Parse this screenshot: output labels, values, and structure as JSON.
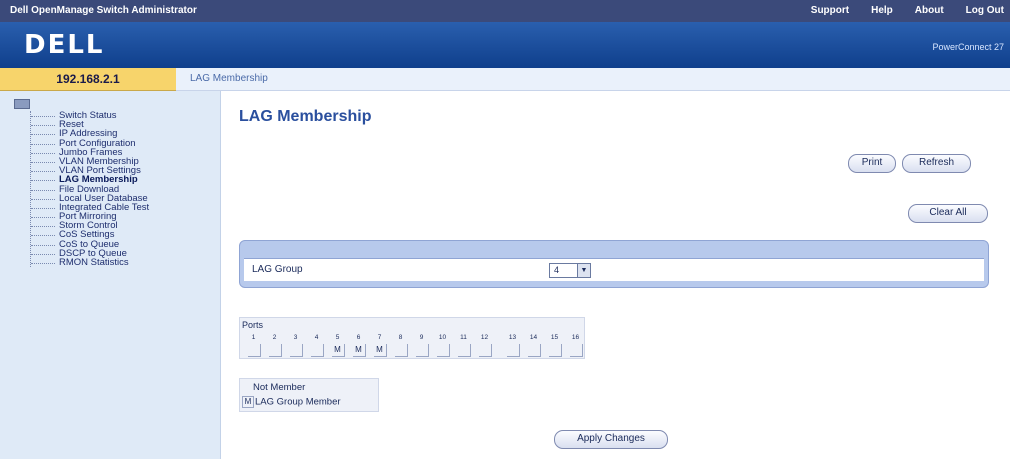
{
  "topbar": {
    "title": "Dell OpenManage Switch Administrator",
    "links": [
      "Support",
      "Help",
      "About",
      "Log Out"
    ]
  },
  "banner": {
    "logo": "DELL",
    "model": "PowerConnect 27"
  },
  "ip": "192.168.2.1",
  "breadcrumb": "LAG Membership",
  "sidebar": {
    "items": [
      {
        "label": "Switch Status"
      },
      {
        "label": "Reset"
      },
      {
        "label": "IP Addressing"
      },
      {
        "label": "Port Configuration"
      },
      {
        "label": "Jumbo Frames"
      },
      {
        "label": "VLAN Membership"
      },
      {
        "label": "VLAN Port Settings"
      },
      {
        "label": "LAG Membership"
      },
      {
        "label": "File Download"
      },
      {
        "label": "Local User Database"
      },
      {
        "label": "Integrated Cable Test"
      },
      {
        "label": "Port Mirroring"
      },
      {
        "label": "Storm Control"
      },
      {
        "label": "CoS Settings"
      },
      {
        "label": "CoS to Queue"
      },
      {
        "label": "DSCP to Queue"
      },
      {
        "label": "RMON Statistics"
      }
    ],
    "active": "LAG Membership"
  },
  "main": {
    "title": "LAG Membership",
    "print_label": "Print",
    "refresh_label": "Refresh",
    "clear_all_label": "Clear All",
    "lag_group_label": "LAG Group",
    "lag_group_value": "4",
    "ports_label": "Ports",
    "ports": [
      {
        "num": "1",
        "state": ""
      },
      {
        "num": "2",
        "state": ""
      },
      {
        "num": "3",
        "state": ""
      },
      {
        "num": "4",
        "state": ""
      },
      {
        "num": "5",
        "state": "M"
      },
      {
        "num": "6",
        "state": "M"
      },
      {
        "num": "7",
        "state": "M"
      },
      {
        "num": "8",
        "state": ""
      },
      {
        "num": "9",
        "state": ""
      },
      {
        "num": "10",
        "state": ""
      },
      {
        "num": "11",
        "state": ""
      },
      {
        "num": "12",
        "state": ""
      },
      {
        "num": "13",
        "state": ""
      },
      {
        "num": "14",
        "state": ""
      },
      {
        "num": "15",
        "state": ""
      },
      {
        "num": "16",
        "state": ""
      }
    ],
    "legend": {
      "not_member": "Not Member",
      "member_mark": "M",
      "member": "LAG Group Member"
    },
    "apply_label": "Apply Changes"
  }
}
